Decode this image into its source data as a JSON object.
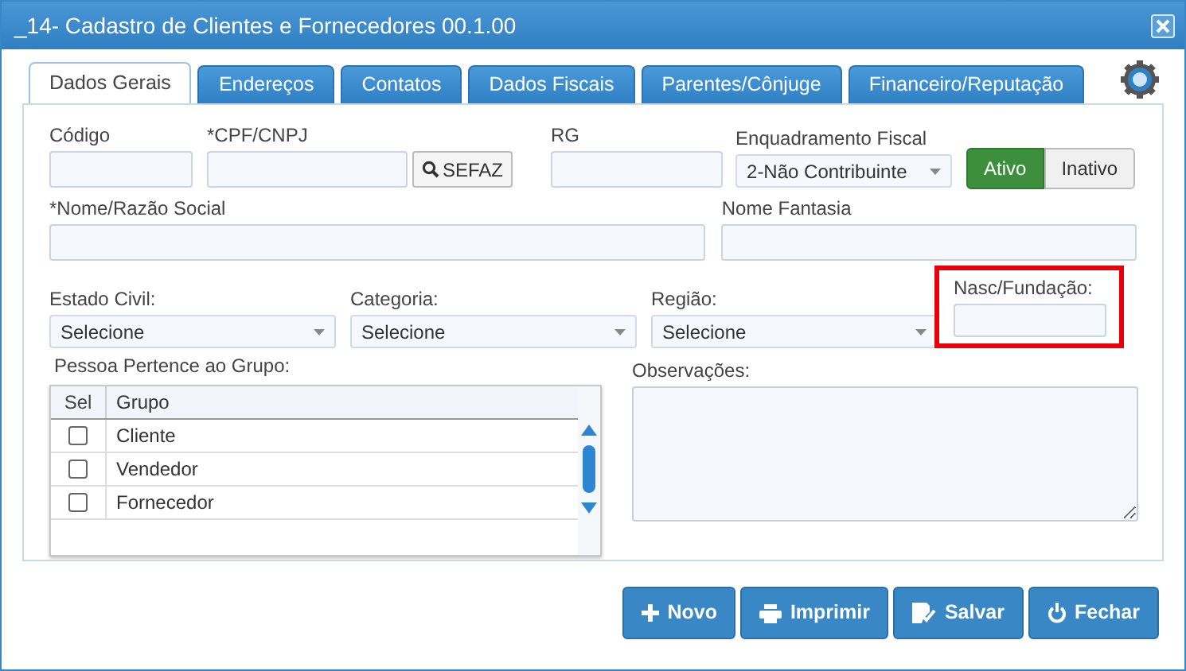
{
  "window": {
    "title": "_14- Cadastro de Clientes e Fornecedores 00.1.00"
  },
  "tabs": [
    {
      "label": "Dados Gerais",
      "selected": true
    },
    {
      "label": "Endereços",
      "selected": false
    },
    {
      "label": "Contatos",
      "selected": false
    },
    {
      "label": "Dados Fiscais",
      "selected": false
    },
    {
      "label": "Parentes/Cônjuge",
      "selected": false
    },
    {
      "label": "Financeiro/Reputação",
      "selected": false
    }
  ],
  "row1": {
    "codigo": {
      "label": "Código"
    },
    "cpf": {
      "label": "*CPF/CNPJ"
    },
    "sefaz_button": "SEFAZ",
    "rg": {
      "label": "RG"
    },
    "enquadramento": {
      "label": "Enquadramento Fiscal",
      "value": "2-Não Contribuinte"
    },
    "status": [
      {
        "label": "Ativo",
        "selected": true
      },
      {
        "label": "Inativo",
        "selected": false
      }
    ]
  },
  "row2": {
    "nome": {
      "label": "*Nome/Razão Social"
    },
    "fantasia": {
      "label": "Nome Fantasia"
    }
  },
  "row3": {
    "selects": [
      {
        "label": "Estado Civil:",
        "value": "Selecione"
      },
      {
        "label": "Categoria:",
        "value": "Selecione"
      },
      {
        "label": "Região:",
        "value": "Selecione"
      }
    ],
    "nasc": {
      "label": "Nasc/Fundação:",
      "highlighted": true
    }
  },
  "grupo": {
    "label": "Pessoa Pertence ao Grupo:",
    "columns": [
      "Sel",
      "Grupo"
    ],
    "rows": [
      {
        "name": "Cliente",
        "checked": false
      },
      {
        "name": "Vendedor",
        "checked": false
      },
      {
        "name": "Fornecedor",
        "checked": false
      }
    ]
  },
  "observacoes": {
    "label": "Observações:"
  },
  "buttons": [
    {
      "kind": "new",
      "label": "Novo"
    },
    {
      "kind": "print",
      "label": "Imprimir"
    },
    {
      "kind": "save",
      "label": "Salvar"
    },
    {
      "kind": "close",
      "label": "Fechar"
    }
  ]
}
